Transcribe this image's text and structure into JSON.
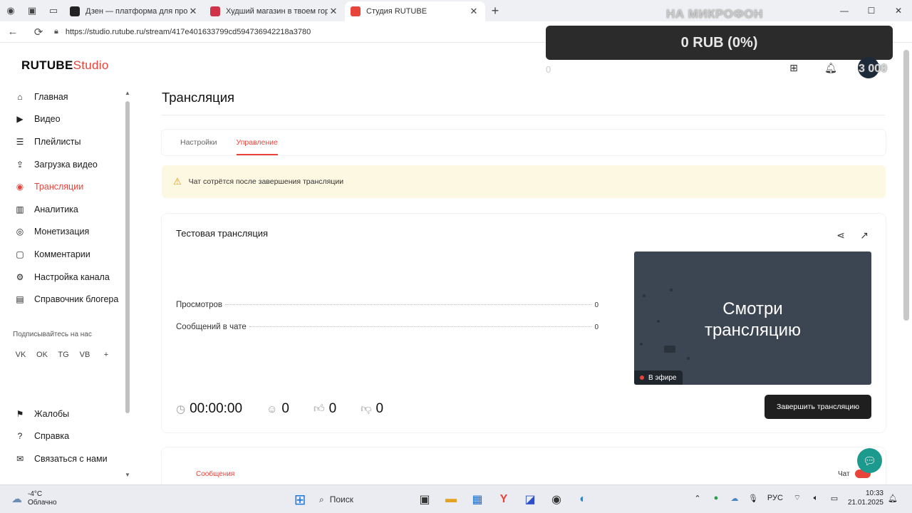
{
  "browser": {
    "tabs": [
      {
        "title": "Дзен — платформа для просмотра",
        "color": "#222222",
        "active": false
      },
      {
        "title": "Худший магазин в твоем городе",
        "color": "#d0324a",
        "active": false
      },
      {
        "title": "Студия RUTUBE",
        "color": "#e8443a",
        "active": true
      }
    ],
    "url": "https://studio.rutube.ru/stream/417e401633799cd594736942218a3780"
  },
  "overlay": {
    "mic_text": "НА МИКРОФОН",
    "donation": "0 RUB (0%)",
    "ghost_zero": "0",
    "avatar_number": "3 000"
  },
  "logo": {
    "brand": "RUTUBE",
    "suffix": "Studio"
  },
  "sidebar": {
    "items": [
      {
        "label": "Главная",
        "icon": "home-icon"
      },
      {
        "label": "Видео",
        "icon": "video-icon"
      },
      {
        "label": "Плейлисты",
        "icon": "playlist-icon"
      },
      {
        "label": "Загрузка видео",
        "icon": "upload-icon"
      },
      {
        "label": "Трансляции",
        "icon": "broadcast-icon",
        "active": true
      },
      {
        "label": "Аналитика",
        "icon": "analytics-icon"
      },
      {
        "label": "Монетизация",
        "icon": "money-icon"
      },
      {
        "label": "Комментарии",
        "icon": "comments-icon"
      },
      {
        "label": "Настройка канала",
        "icon": "settings-icon"
      },
      {
        "label": "Справочник блогера",
        "icon": "book-icon"
      }
    ],
    "subscribe_label": "Подписывайтесь на нас",
    "socials": [
      "VK",
      "OK",
      "TG",
      "VB",
      "+"
    ],
    "bottom": [
      {
        "label": "Жалобы",
        "icon": "flag-icon"
      },
      {
        "label": "Справка",
        "icon": "help-icon"
      },
      {
        "label": "Связаться с нами",
        "icon": "mail-icon"
      }
    ]
  },
  "main": {
    "title": "Трансляция",
    "tabs": [
      "Настройки",
      "Управление"
    ],
    "active_tab": "Управление",
    "warning": "Чат сотрётся после завершения трансляции",
    "stream": {
      "title": "Тестовая трансляция",
      "stats": [
        {
          "label": "Просмотров",
          "value": "0"
        },
        {
          "label": "Сообщений в чате",
          "value": "0"
        }
      ],
      "preview_line1": "Смотри",
      "preview_line2": "трансляцию",
      "live_label": "В эфире",
      "duration": "00:00:00",
      "viewers": "0",
      "likes": "0",
      "dislikes": "0",
      "end_button": "Завершить трансляцию"
    },
    "messages_label": "Сообщения",
    "chat_label": "Чат"
  },
  "taskbar": {
    "temperature": "-4°C",
    "condition": "Облачно",
    "search_placeholder": "Поиск",
    "language": "РУС",
    "time": "10:33",
    "date": "21.01.2025"
  },
  "colors": {
    "accent": "#e8443a",
    "warning_bg": "#fdf8e2",
    "preview_bg": "#3c4652",
    "fab": "#1d9a8e"
  }
}
